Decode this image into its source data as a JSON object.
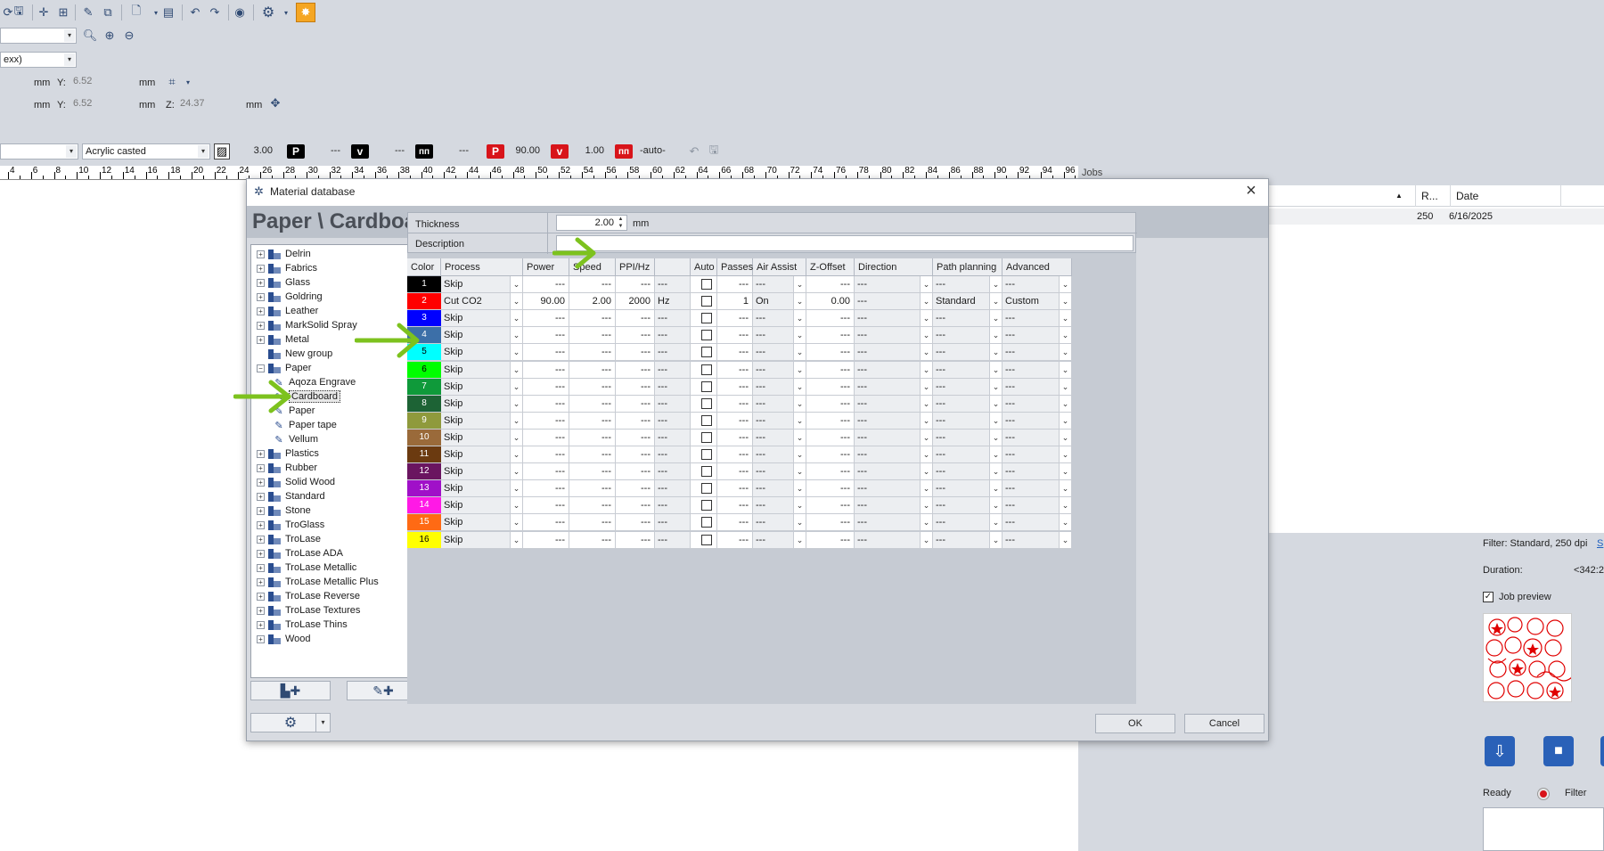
{
  "toolbar": {
    "icons": [
      "open-icon",
      "save-icon",
      "node-icon",
      "node-add-icon",
      "pen-icon",
      "copy-icon",
      "new-document-icon",
      "layer-icon",
      "undo-icon",
      "redo-icon",
      "eye-icon",
      "gear-icon",
      "laser-icon"
    ],
    "zoom_combo": "",
    "font_combo": "exx)",
    "pos1": {
      "x_unit": "mm",
      "y_label": "Y:",
      "y_value": "6.52",
      "y_unit": "mm"
    },
    "pos2": {
      "x_unit": "mm",
      "y_label": "Y:",
      "y_value": "6.52",
      "y_unit": "mm",
      "z_label": "Z:",
      "z_value": "24.37",
      "z_unit": "mm"
    },
    "material_combo": "",
    "material_type": "Acrylic casted",
    "thickness": "3.00",
    "p1": {
      "label": "P",
      "value": "---"
    },
    "v1": {
      "label": "v",
      "value": "---"
    },
    "f1": {
      "value": "---"
    },
    "p2": {
      "label": "P",
      "value": "90.00"
    },
    "v2": {
      "label": "v",
      "value": "1.00"
    },
    "f2": {
      "value": "-auto-"
    }
  },
  "ruler": {
    "ticks": [
      "4",
      "6",
      "8",
      "10",
      "12",
      "14",
      "16",
      "18",
      "20",
      "22",
      "24",
      "26",
      "28",
      "30",
      "32",
      "34",
      "36",
      "38",
      "40",
      "42",
      "44",
      "46",
      "48",
      "50",
      "52",
      "54",
      "56",
      "58",
      "60",
      "62",
      "64",
      "66",
      "68",
      "70",
      "72",
      "74",
      "76",
      "78",
      "80",
      "82",
      "84",
      "86",
      "88",
      "90",
      "92",
      "94",
      "96"
    ]
  },
  "jobs": {
    "header": "Jobs",
    "col_r": "R...",
    "col_date": "Date",
    "row": {
      "r": "250",
      "date": "6/16/2025"
    },
    "filter": "Filter: Standard, 250 dpi",
    "filter_link": "S",
    "duration_label": "Duration:",
    "duration_value": "<342:2",
    "job_preview_label": "Job preview",
    "job_preview_checked": true,
    "status_ready": "Ready",
    "status_filter": "Filter"
  },
  "dialog": {
    "title": "Material database",
    "heading": "Paper \\ Cardboard",
    "thickness_label": "Thickness",
    "thickness_value": "2.00",
    "thickness_unit": "mm",
    "description_label": "Description",
    "description_value": "",
    "ok_label": "OK",
    "cancel_label": "Cancel",
    "tree": [
      {
        "label": "Delrin",
        "level": 0,
        "type": "folder",
        "expanded": false
      },
      {
        "label": "Fabrics",
        "level": 0,
        "type": "folder",
        "expanded": false
      },
      {
        "label": "Glass",
        "level": 0,
        "type": "folder",
        "expanded": false
      },
      {
        "label": "Goldring",
        "level": 0,
        "type": "folder",
        "expanded": false
      },
      {
        "label": "Leather",
        "level": 0,
        "type": "folder",
        "expanded": false
      },
      {
        "label": "MarkSolid Spray",
        "level": 0,
        "type": "folder",
        "expanded": false
      },
      {
        "label": "Metal",
        "level": 0,
        "type": "folder",
        "expanded": false
      },
      {
        "label": "New group",
        "level": 0,
        "type": "folder",
        "expanded": null
      },
      {
        "label": "Paper",
        "level": 0,
        "type": "folder",
        "expanded": true
      },
      {
        "label": "Aqoza Engrave",
        "level": 1,
        "type": "material"
      },
      {
        "label": "Cardboard",
        "level": 1,
        "type": "material",
        "selected": true
      },
      {
        "label": "Paper",
        "level": 1,
        "type": "material"
      },
      {
        "label": "Paper tape",
        "level": 1,
        "type": "material"
      },
      {
        "label": "Vellum",
        "level": 1,
        "type": "material"
      },
      {
        "label": "Plastics",
        "level": 0,
        "type": "folder",
        "expanded": false
      },
      {
        "label": "Rubber",
        "level": 0,
        "type": "folder",
        "expanded": false
      },
      {
        "label": "Solid Wood",
        "level": 0,
        "type": "folder",
        "expanded": false
      },
      {
        "label": "Standard",
        "level": 0,
        "type": "folder",
        "expanded": false
      },
      {
        "label": "Stone",
        "level": 0,
        "type": "folder",
        "expanded": false
      },
      {
        "label": "TroGlass",
        "level": 0,
        "type": "folder",
        "expanded": false
      },
      {
        "label": "TroLase",
        "level": 0,
        "type": "folder",
        "expanded": false
      },
      {
        "label": "TroLase ADA",
        "level": 0,
        "type": "folder",
        "expanded": false
      },
      {
        "label": "TroLase Metallic",
        "level": 0,
        "type": "folder",
        "expanded": false
      },
      {
        "label": "TroLase Metallic Plus",
        "level": 0,
        "type": "folder",
        "expanded": false
      },
      {
        "label": "TroLase Reverse",
        "level": 0,
        "type": "folder",
        "expanded": false
      },
      {
        "label": "TroLase Textures",
        "level": 0,
        "type": "folder",
        "expanded": false
      },
      {
        "label": "TroLase Thins",
        "level": 0,
        "type": "folder",
        "expanded": false
      },
      {
        "label": "Wood",
        "level": 0,
        "type": "folder",
        "expanded": false
      }
    ],
    "columns": [
      "Color",
      "Process",
      "Power",
      "Speed",
      "PPI/Hz",
      "",
      "Auto",
      "Passes",
      "Air Assist",
      "Z-Offset",
      "Direction",
      "Path planning",
      "Advanced"
    ],
    "rows": [
      {
        "n": "1",
        "color": "#000000",
        "process": "Skip",
        "power": "---",
        "speed": "---",
        "ppi": "---",
        "unit": "---",
        "passes": "---",
        "air": "---",
        "zoff": "---",
        "dir": "---",
        "path": "---",
        "adv": "---"
      },
      {
        "n": "2",
        "color": "#ff0000",
        "process": "Cut CO2",
        "power": "90.00",
        "speed": "2.00",
        "ppi": "2000",
        "unit": "Hz",
        "passes": "1",
        "air": "On",
        "zoff": "0.00",
        "dir": "---",
        "path": "Standard",
        "adv": "Custom"
      },
      {
        "n": "3",
        "color": "#0000ff",
        "process": "Skip",
        "power": "---",
        "speed": "---",
        "ppi": "---",
        "unit": "---",
        "passes": "---",
        "air": "---",
        "zoff": "---",
        "dir": "---",
        "path": "---",
        "adv": "---"
      },
      {
        "n": "4",
        "color": "#3c6fa8",
        "process": "Skip",
        "power": "---",
        "speed": "---",
        "ppi": "---",
        "unit": "---",
        "passes": "---",
        "air": "---",
        "zoff": "---",
        "dir": "---",
        "path": "---",
        "adv": "---"
      },
      {
        "n": "5",
        "color": "#00ffff",
        "process": "Skip",
        "power": "---",
        "speed": "---",
        "ppi": "---",
        "unit": "---",
        "passes": "---",
        "air": "---",
        "zoff": "---",
        "dir": "---",
        "path": "---",
        "adv": "---"
      },
      {
        "n": "6",
        "color": "#00ff00",
        "process": "Skip",
        "power": "---",
        "speed": "---",
        "ppi": "---",
        "unit": "---",
        "passes": "---",
        "air": "---",
        "zoff": "---",
        "dir": "---",
        "path": "---",
        "adv": "---"
      },
      {
        "n": "7",
        "color": "#0f9a3a",
        "process": "Skip",
        "power": "---",
        "speed": "---",
        "ppi": "---",
        "unit": "---",
        "passes": "---",
        "air": "---",
        "zoff": "---",
        "dir": "---",
        "path": "---",
        "adv": "---"
      },
      {
        "n": "8",
        "color": "#1d6335",
        "process": "Skip",
        "power": "---",
        "speed": "---",
        "ppi": "---",
        "unit": "---",
        "passes": "---",
        "air": "---",
        "zoff": "---",
        "dir": "---",
        "path": "---",
        "adv": "---"
      },
      {
        "n": "9",
        "color": "#8f9a3c",
        "process": "Skip",
        "power": "---",
        "speed": "---",
        "ppi": "---",
        "unit": "---",
        "passes": "---",
        "air": "---",
        "zoff": "---",
        "dir": "---",
        "path": "---",
        "adv": "---"
      },
      {
        "n": "10",
        "color": "#9a6a3a",
        "process": "Skip",
        "power": "---",
        "speed": "---",
        "ppi": "---",
        "unit": "---",
        "passes": "---",
        "air": "---",
        "zoff": "---",
        "dir": "---",
        "path": "---",
        "adv": "---"
      },
      {
        "n": "11",
        "color": "#6b3a10",
        "process": "Skip",
        "power": "---",
        "speed": "---",
        "ppi": "---",
        "unit": "---",
        "passes": "---",
        "air": "---",
        "zoff": "---",
        "dir": "---",
        "path": "---",
        "adv": "---"
      },
      {
        "n": "12",
        "color": "#6a1560",
        "process": "Skip",
        "power": "---",
        "speed": "---",
        "ppi": "---",
        "unit": "---",
        "passes": "---",
        "air": "---",
        "zoff": "---",
        "dir": "---",
        "path": "---",
        "adv": "---"
      },
      {
        "n": "13",
        "color": "#a010c8",
        "process": "Skip",
        "power": "---",
        "speed": "---",
        "ppi": "---",
        "unit": "---",
        "passes": "---",
        "air": "---",
        "zoff": "---",
        "dir": "---",
        "path": "---",
        "adv": "---"
      },
      {
        "n": "14",
        "color": "#ff19e6",
        "process": "Skip",
        "power": "---",
        "speed": "---",
        "ppi": "---",
        "unit": "---",
        "passes": "---",
        "air": "---",
        "zoff": "---",
        "dir": "---",
        "path": "---",
        "adv": "---"
      },
      {
        "n": "15",
        "color": "#ff6a14",
        "process": "Skip",
        "power": "---",
        "speed": "---",
        "ppi": "---",
        "unit": "---",
        "passes": "---",
        "air": "---",
        "zoff": "---",
        "dir": "---",
        "path": "---",
        "adv": "---"
      },
      {
        "n": "16",
        "color": "#ffff00",
        "process": "Skip",
        "power": "---",
        "speed": "---",
        "ppi": "---",
        "unit": "---",
        "passes": "---",
        "air": "---",
        "zoff": "---",
        "dir": "---",
        "path": "---",
        "adv": "---"
      }
    ],
    "icons": {
      "add_group": "add-folder-icon",
      "add_material": "add-material-icon",
      "settings": "gear-icon"
    }
  },
  "annotation_color": "#7dc21e"
}
